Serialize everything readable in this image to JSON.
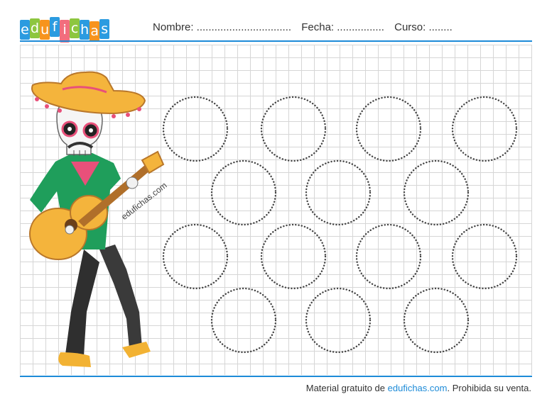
{
  "logo": {
    "letters": [
      {
        "ch": "e",
        "color": "#2b9be0"
      },
      {
        "ch": "d",
        "color": "#8dc63f"
      },
      {
        "ch": "u",
        "color": "#f7941d"
      },
      {
        "ch": "f",
        "color": "#2b9be0"
      },
      {
        "ch": "i",
        "color": "#f26d7d"
      },
      {
        "ch": "c",
        "color": "#8dc63f"
      },
      {
        "ch": "h",
        "color": "#2b9be0"
      },
      {
        "ch": "a",
        "color": "#f7941d"
      },
      {
        "ch": "s",
        "color": "#2b9be0"
      }
    ]
  },
  "header": {
    "nombre": "Nombre: ................................",
    "fecha": "Fecha: ................",
    "curso": "Curso: ........"
  },
  "watermark": "edufichas.com",
  "footer": {
    "prefix": "Material gratuito de ",
    "brand": "edufichas.com",
    "suffix": ". Prohibida su venta."
  },
  "colors": {
    "accent": "#1d8bd8"
  }
}
